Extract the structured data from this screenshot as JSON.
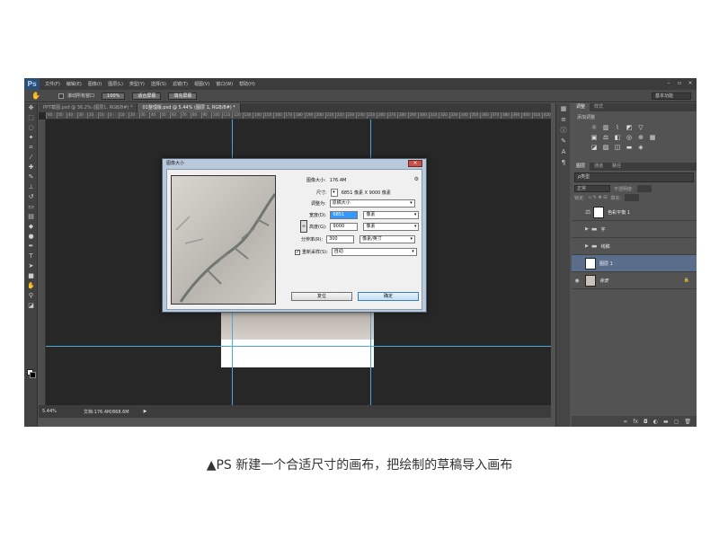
{
  "app": {
    "logo": "Ps",
    "menu": [
      "文件(F)",
      "编辑(E)",
      "图像(I)",
      "图层(L)",
      "类型(Y)",
      "选择(S)",
      "滤镜(T)",
      "视图(V)",
      "窗口(W)",
      "帮助(H)"
    ],
    "workspace": "基本功能"
  },
  "options_bar": {
    "scroll_all_label": "滚动所有窗口",
    "btn_100": "100%",
    "btn_fit": "适合屏幕",
    "btn_fill": "填充屏幕"
  },
  "doc": {
    "tabs": [
      "PPT截图.psd @ 36.2% (图层1, RGB/8#) *",
      "01整理版.psd @ 5.44% (图层 1, RGB/8#) *"
    ],
    "ruler_ticks": [
      "60",
      "50",
      "40",
      "30",
      "20",
      "10",
      "0",
      "10",
      "20",
      "30",
      "40",
      "50",
      "60",
      "70",
      "80",
      "90",
      "100",
      "110",
      "120",
      "130",
      "140",
      "150",
      "160",
      "170",
      "180",
      "190",
      "200",
      "210",
      "220",
      "230",
      "240",
      "250",
      "260",
      "270",
      "280",
      "290",
      "300",
      "310",
      "320",
      "330",
      "340",
      "350",
      "360",
      "370",
      "380",
      "390",
      "400",
      "410",
      "420",
      "430",
      "440",
      "450",
      "460",
      "470",
      "480",
      "490",
      "500",
      "510",
      "520",
      "530",
      "540",
      "550",
      "560",
      "570",
      "580",
      "590",
      "600",
      "610",
      "620",
      "630",
      "640",
      "650",
      "660",
      "670",
      "680",
      "690",
      "700",
      "710",
      "720"
    ],
    "zoom": "5.44%",
    "doc_info": "文档:176.4M/868.6M"
  },
  "panels": {
    "adjust_tabs": [
      "调整",
      "样式"
    ],
    "adjust_add": "添加调整",
    "layer_tabs": [
      "图层",
      "通道",
      "路径"
    ],
    "search_kind": "ρ类型",
    "blend_mode": "正常",
    "opacity_label": "不透明度:",
    "lock_label": "锁定:",
    "fill_label": "填充:",
    "layers": [
      {
        "name": "色彩平衡 1",
        "type": "adjust"
      },
      {
        "name": "字",
        "type": "folder"
      },
      {
        "name": "线稿",
        "type": "folder"
      },
      {
        "name": "图层 1",
        "type": "layer"
      },
      {
        "name": "背景",
        "type": "background"
      }
    ]
  },
  "dialog": {
    "title": "图像大小",
    "size_label": "图像大小:",
    "size_value": "176.4M",
    "dims_label": "尺寸:",
    "dims_value": "6851 像素 X 9000 像素",
    "fit_label": "调整为:",
    "fit_value": "原稿大小",
    "width_label": "宽度(D):",
    "width_value": "6851",
    "width_unit": "像素",
    "height_label": "高度(G):",
    "height_value": "9000",
    "height_unit": "像素",
    "res_label": "分辨率(R):",
    "res_value": "300",
    "res_unit": "像素/英寸",
    "resample_label": "重新采样(S):",
    "resample_value": "自动",
    "reset_btn": "复位",
    "ok_btn": "确定"
  },
  "caption": "▲PS 新建一个合适尺寸的画布，把绘制的草稿导入画布",
  "colors": {
    "guide": "#4aa7d6",
    "selected_layer": "#5a6e8c",
    "dialog_frame": "#b9c9dc"
  }
}
